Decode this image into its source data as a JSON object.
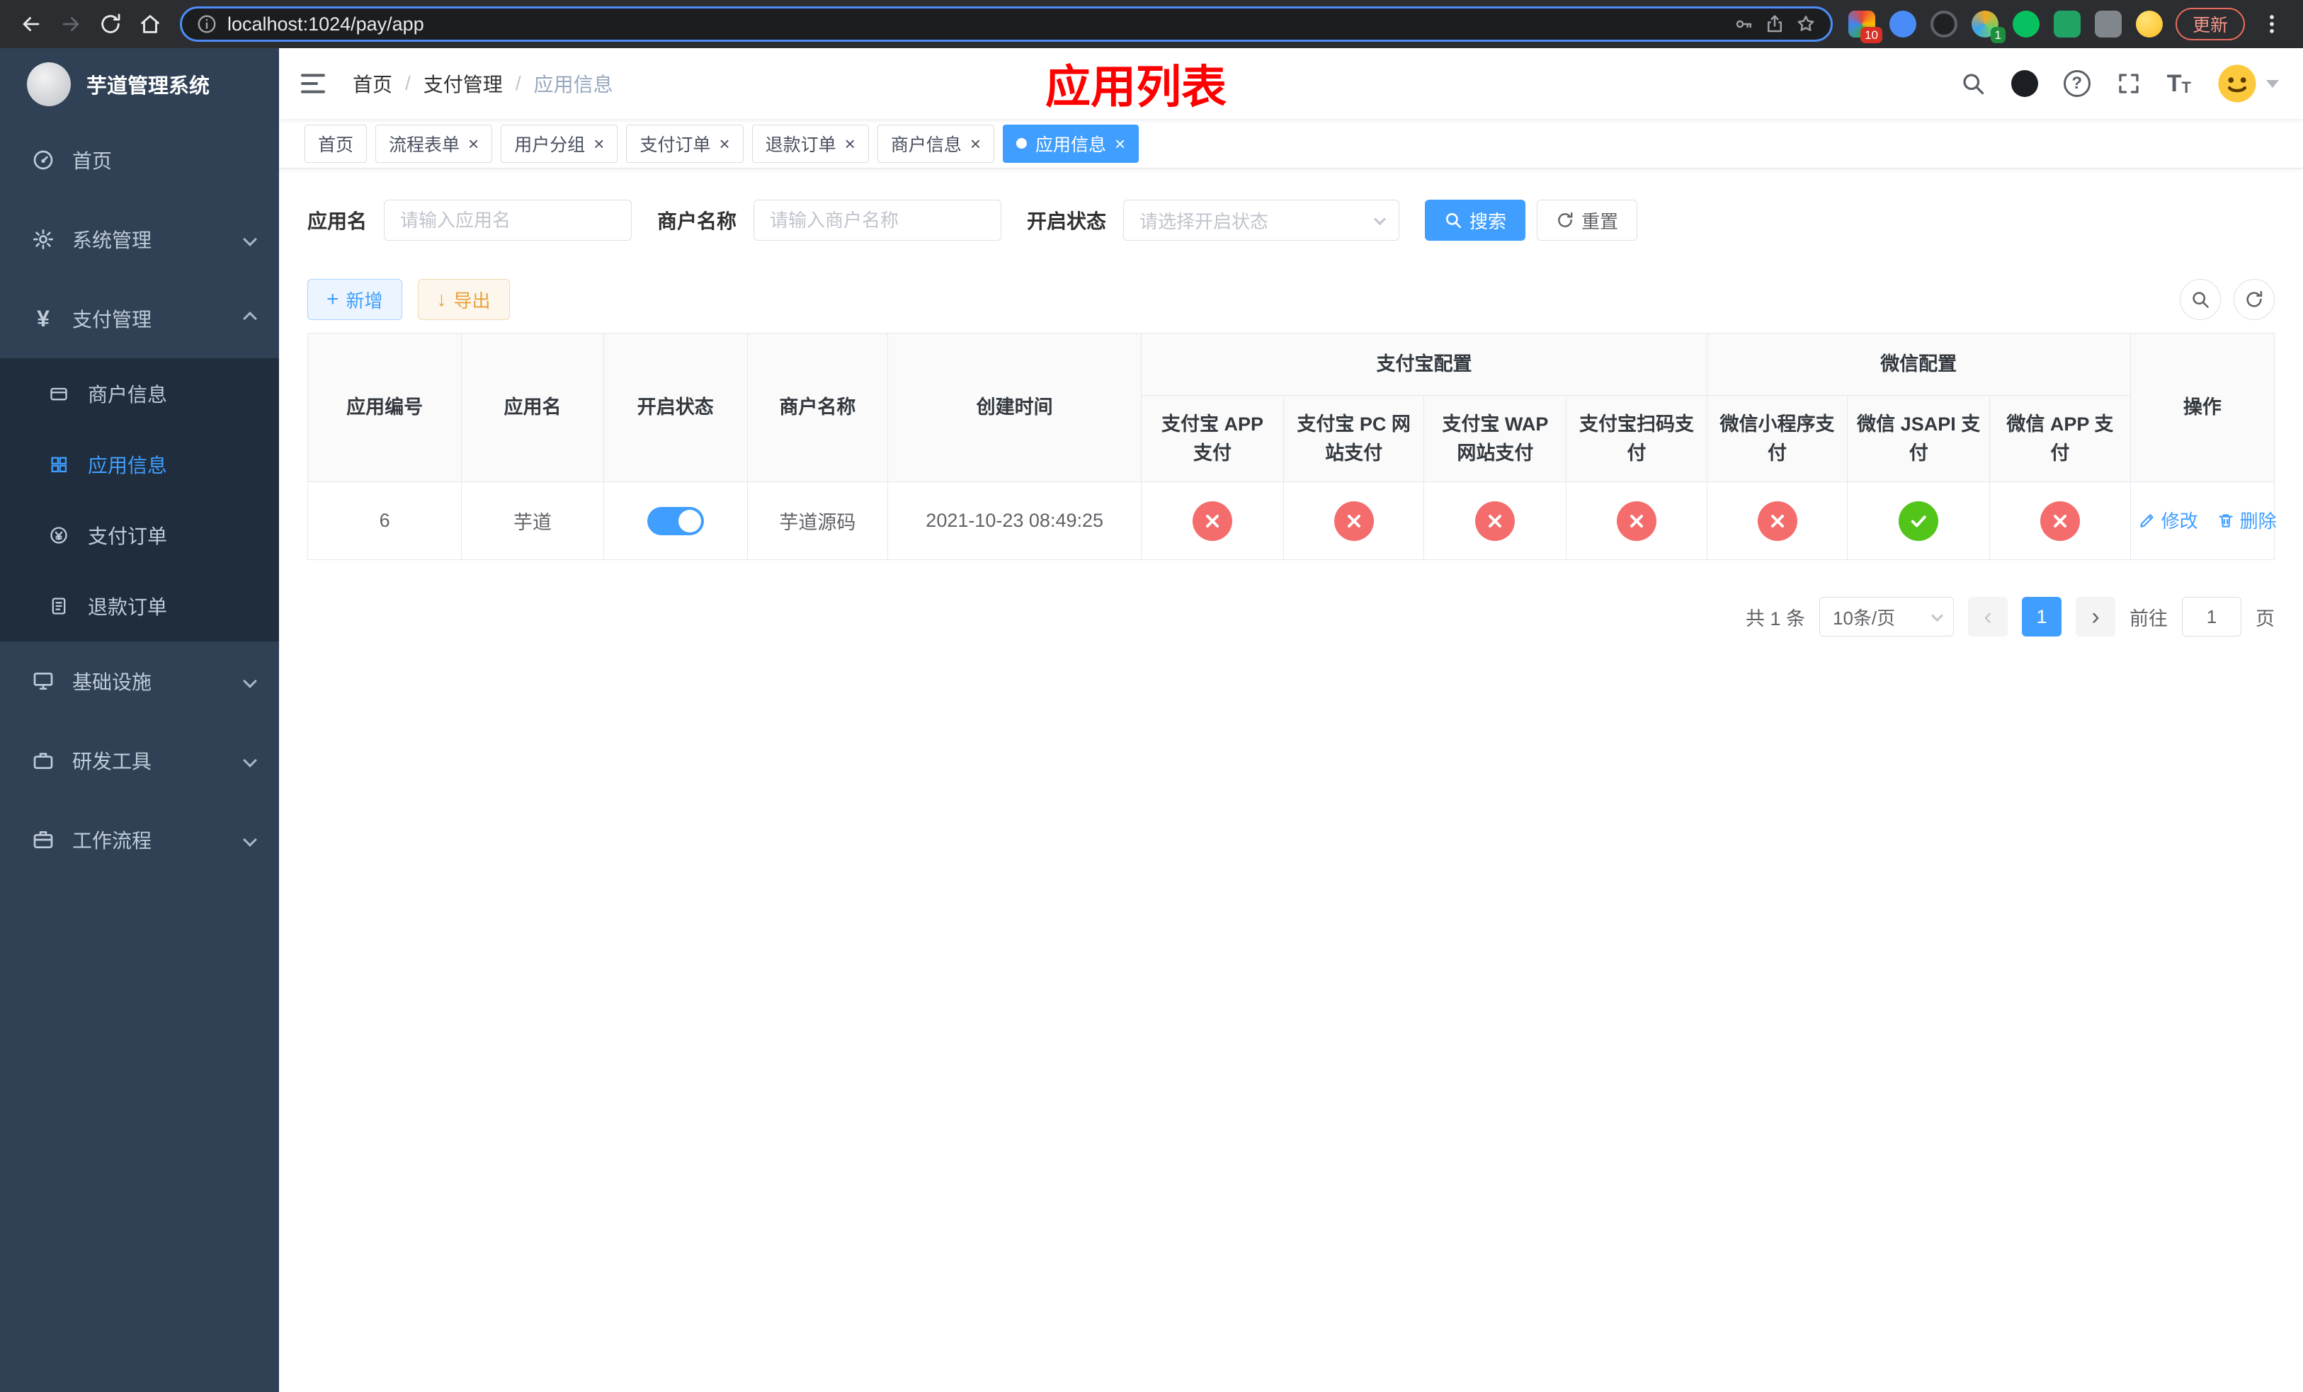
{
  "colors": {
    "accent": "#409eff",
    "danger": "#f56c6c",
    "success": "#52c41a",
    "warning": "#e6a23c",
    "titlered": "#ff0000"
  },
  "icons": {
    "close": "×",
    "plus": "+",
    "download": "↓"
  },
  "browser": {
    "url": "localhost:1024/pay/app",
    "update_button": "更新",
    "extension_badge_count": "10",
    "profile_badge_count": "1"
  },
  "sidebar": {
    "brand": "芋道管理系统",
    "menu": [
      {
        "label": "首页"
      },
      {
        "label": "系统管理"
      },
      {
        "label": "支付管理",
        "children": [
          {
            "label": "商户信息"
          },
          {
            "label": "应用信息"
          },
          {
            "label": "支付订单"
          },
          {
            "label": "退款订单"
          }
        ]
      },
      {
        "label": "基础设施"
      },
      {
        "label": "研发工具"
      },
      {
        "label": "工作流程"
      }
    ]
  },
  "header": {
    "breadcrumb": [
      "首页",
      "支付管理",
      "应用信息"
    ],
    "page_title": "应用列表"
  },
  "tabs": [
    {
      "label": "首页",
      "closable": false
    },
    {
      "label": "流程表单",
      "closable": true
    },
    {
      "label": "用户分组",
      "closable": true
    },
    {
      "label": "支付订单",
      "closable": true
    },
    {
      "label": "退款订单",
      "closable": true
    },
    {
      "label": "商户信息",
      "closable": true
    },
    {
      "label": "应用信息",
      "closable": true,
      "active": true
    }
  ],
  "filters": {
    "app_name": {
      "label": "应用名",
      "placeholder": "请输入应用名",
      "value": ""
    },
    "merchant_name": {
      "label": "商户名称",
      "placeholder": "请输入商户名称",
      "value": ""
    },
    "status": {
      "label": "开启状态",
      "placeholder": "请选择开启状态",
      "value": ""
    },
    "search_button": "搜索",
    "reset_button": "重置"
  },
  "toolbar": {
    "add_button": "新增",
    "export_button": "导出"
  },
  "table": {
    "headers": {
      "app_id": "应用编号",
      "app_name": "应用名",
      "status": "开启状态",
      "merchant_name": "商户名称",
      "create_time": "创建时间",
      "actions": "操作"
    },
    "groups": {
      "alipay": {
        "label": "支付宝配置",
        "cols": [
          "支付宝 APP 支付",
          "支付宝 PC 网站支付",
          "支付宝 WAP 网站支付",
          "支付宝扫码支付"
        ]
      },
      "wechat": {
        "label": "微信配置",
        "cols": [
          "微信小程序支付",
          "微信 JSAPI 支付",
          "微信 APP 支付"
        ]
      }
    },
    "rows": [
      {
        "app_id": "6",
        "app_name": "芋道",
        "enabled": true,
        "merchant_name": "芋道源码",
        "create_time": "2021-10-23 08:49:25",
        "alipay": [
          false,
          false,
          false,
          false
        ],
        "wechat": [
          false,
          true,
          false
        ],
        "edit": "修改",
        "delete": "删除"
      }
    ]
  },
  "pagination": {
    "total": "共 1 条",
    "page_size": "10条/页",
    "page": "1",
    "goto_label": "前往",
    "goto_value": "1",
    "goto_unit": "页"
  }
}
